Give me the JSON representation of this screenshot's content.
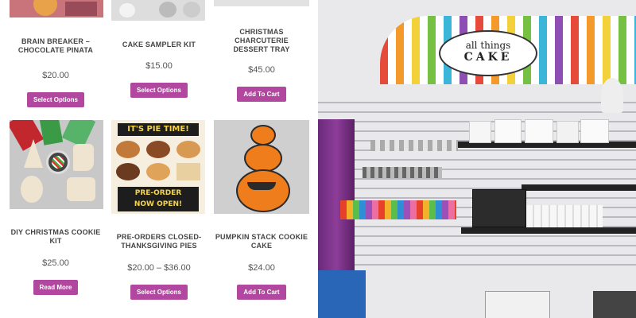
{
  "products": [
    {
      "title": "BRAIN BREAKER –\nCHOCOLATE PINATA",
      "price": "$20.00",
      "button": "Select Options"
    },
    {
      "title": "CAKE SAMPLER KIT",
      "price": "$15.00",
      "button": "Select Options"
    },
    {
      "title": "CHRISTMAS CHARCUTERIE\nDESSERT TRAY",
      "price": "$45.00",
      "button": "Add To Cart"
    },
    {
      "title": "DIY CHRISTMAS COOKIE KIT",
      "price": "$25.00",
      "button": "Read More"
    },
    {
      "title": "PRE-ORDERS CLOSED-\nTHANKSGIVING PIES",
      "price": "$20.00 – $36.00",
      "button": "Select Options"
    },
    {
      "title": "PUMPKIN STACK COOKIE\nCAKE",
      "price": "$24.00",
      "button": "Add To Cart"
    }
  ],
  "pie_image": {
    "line1": "IT'S PIE TIME!",
    "line2": "PRE-ORDER",
    "line3": "NOW OPEN!"
  },
  "store_sign": {
    "line1": "all things",
    "line2": "CAKE"
  },
  "colors": {
    "button": "#b1479e",
    "brand_purple": "#7a2a8a"
  }
}
